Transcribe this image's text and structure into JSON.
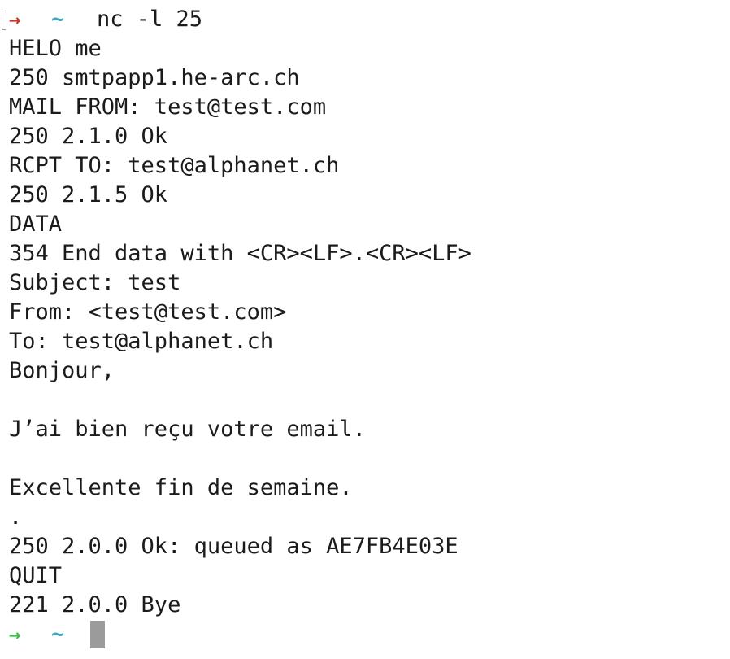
{
  "terminal": {
    "first_prompt": {
      "arrow": "→",
      "cwd": "~",
      "command": "nc -l 25"
    },
    "lines": [
      "HELO me",
      "250 smtpapp1.he-arc.ch",
      "MAIL FROM: test@test.com",
      "250 2.1.0 Ok",
      "RCPT TO: test@alphanet.ch",
      "250 2.1.5 Ok",
      "DATA",
      "354 End data with <CR><LF>.<CR><LF>",
      "Subject: test",
      "From: <test@test.com>",
      "To: test@alphanet.ch",
      "Bonjour,",
      "",
      "J’ai bien reçu votre email.",
      "",
      "Excellente fin de semaine.",
      ".",
      "250 2.0.0 Ok: queued as AE7FB4E03E",
      "QUIT",
      "221 2.0.0 Bye"
    ],
    "last_prompt": {
      "arrow": "→",
      "cwd": "~"
    }
  },
  "colors": {
    "error_arrow": "#c0392b",
    "success_arrow": "#3dbb4f",
    "cwd": "#3fa7b9",
    "text": "#1b1b1b",
    "cursor": "#9b9b9b"
  },
  "icons": {
    "mark": "mark-bracket-icon",
    "prompt": "prompt-arrow-icon",
    "cursor": "block-cursor-icon"
  }
}
